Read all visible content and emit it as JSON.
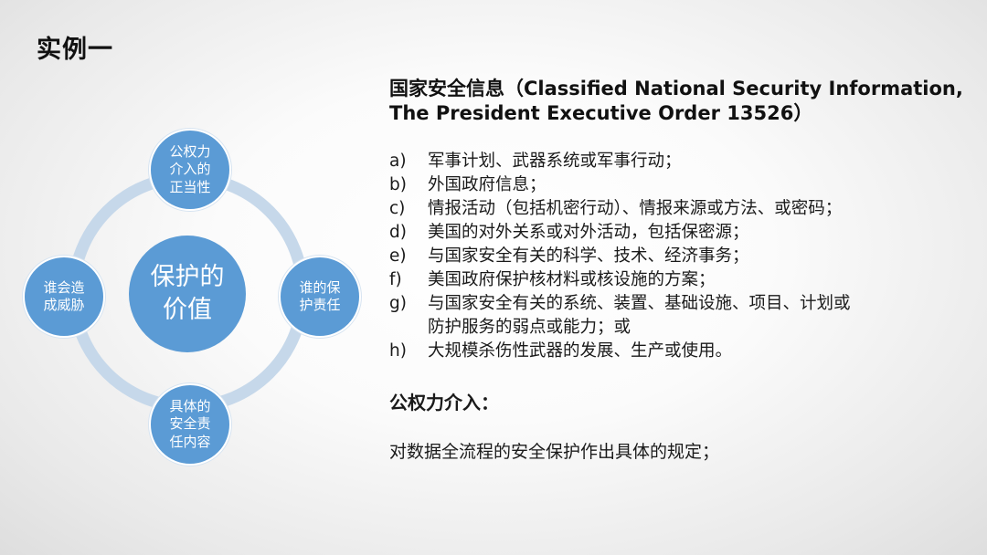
{
  "slide": {
    "title": "实例一"
  },
  "diagram": {
    "center": "保护的\n价值",
    "top": "公权力\n介入的\n正当性",
    "left": "谁会造\n成威胁",
    "right": "谁的保\n护责任",
    "bottom": "具体的\n安全责\n任内容",
    "colors": {
      "node": "#5b9bd5",
      "ring": "#c6d8ea"
    }
  },
  "panel": {
    "heading": "国家安全信息（Classified National Security Information,\nThe President Executive Order 13526）",
    "items": [
      {
        "marker": "a)",
        "text": "军事计划、武器系统或军事行动；"
      },
      {
        "marker": "b)",
        "text": "外国政府信息；"
      },
      {
        "marker": "c)",
        "text": "情报活动（包括机密行动）、情报来源或方法、或密码；"
      },
      {
        "marker": "d)",
        "text": "美国的对外关系或对外活动，包括保密源；"
      },
      {
        "marker": "e)",
        "text": "与国家安全有关的科学、技术、经济事务；"
      },
      {
        "marker": "f)",
        "text": "美国政府保护核材料或核设施的方案；"
      },
      {
        "marker": "g)",
        "text": "与国家安全有关的系统、装置、基础设施、项目、计划或\n防护服务的弱点或能力；或"
      },
      {
        "marker": "h)",
        "text": "大规模杀伤性武器的发展、生产或使用。"
      }
    ],
    "subheading": "公权力介入：",
    "paragraph": "对数据全流程的安全保护作出具体的规定；"
  }
}
